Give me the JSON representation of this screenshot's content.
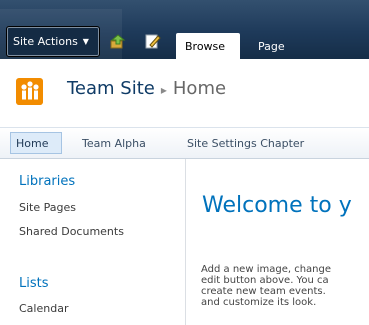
{
  "ribbon": {
    "site_actions_label": "Site Actions",
    "tabs": [
      {
        "label": "Browse",
        "selected": true
      },
      {
        "label": "Page",
        "selected": false
      }
    ],
    "colors": {
      "bar": "#1e3a5a",
      "selected_tab": "#ffffff"
    }
  },
  "title_area": {
    "site_title": "Team Site",
    "breadcrumb_separator": "▸",
    "page_title": "Home",
    "logo_icon": "team-site-logo-icon",
    "logo_color": "#f28c00"
  },
  "top_nav": {
    "items": [
      {
        "label": "Home",
        "selected": true
      },
      {
        "label": "Team Alpha",
        "selected": false
      },
      {
        "label": "Site Settings Chapter",
        "selected": false
      }
    ]
  },
  "quick_launch": {
    "libraries": {
      "heading": "Libraries",
      "items": [
        "Site Pages",
        "Shared Documents"
      ]
    },
    "lists": {
      "heading": "Lists",
      "items": [
        "Calendar"
      ]
    },
    "heading_color": "#0072bc"
  },
  "main": {
    "welcome_heading": "Welcome to y",
    "body_lines": [
      "Add a new image, change",
      "edit button above. You ca",
      "create new team events.",
      "and customize its look."
    ]
  }
}
